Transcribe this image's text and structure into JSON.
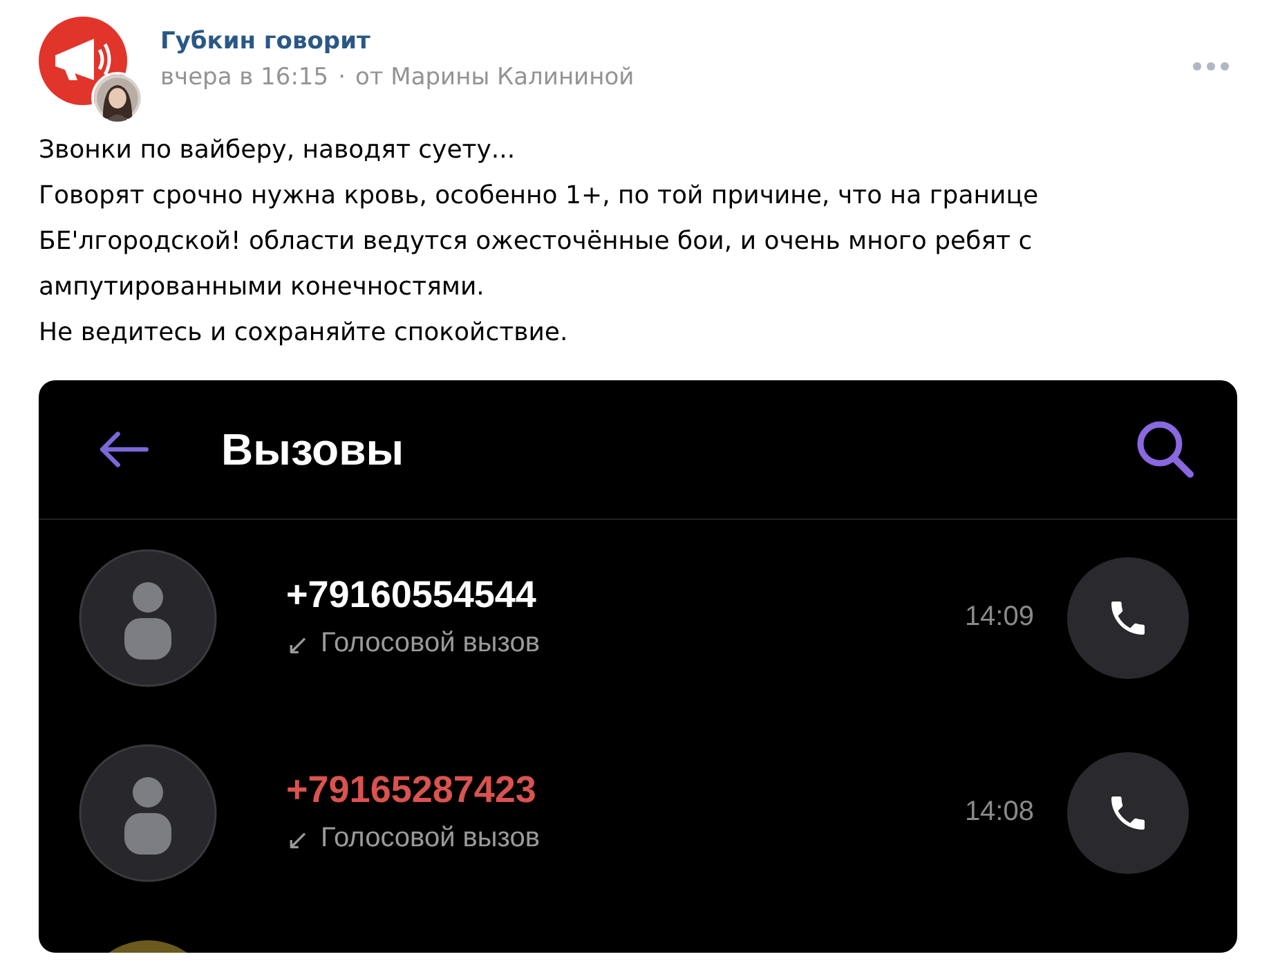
{
  "post": {
    "author": "Губкин говорит",
    "time": "вчера в 16:15",
    "separator": "·",
    "signed_by": "от Марины Калининой"
  },
  "text": [
    "Звонки по вайберу, наводят суету...",
    "Говорят срочно нужна кровь, особенно 1+, по той причине, что на границе БЕ'лгородской! области ведутся ожесточённые бои, и очень много ребят с ампутированными конечностями.",
    "Не ведитесь и сохраняйте спокойствие."
  ],
  "screenshot": {
    "title": "Вызовы",
    "calls": [
      {
        "kind": "contact",
        "number": "+79160554544",
        "missed": false,
        "direction": "↙",
        "type": "Голосовой вызов",
        "time": "14:09"
      },
      {
        "kind": "contact",
        "number": "+79165287423",
        "missed": true,
        "direction": "↙",
        "type": "Голосовой вызов",
        "time": "14:08"
      },
      {
        "kind": "picture"
      }
    ]
  }
}
